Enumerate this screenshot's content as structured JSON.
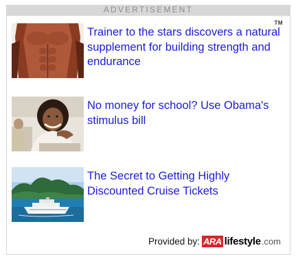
{
  "header": {
    "label": "ADVERTISEMENT"
  },
  "ad_box": {
    "tm_mark": "TM"
  },
  "ads": [
    {
      "headline": "Trainer to the stars discovers a natural supplement for building strength and endurance",
      "image": "muscular-torso-photo"
    },
    {
      "headline": "No money for school? Use Obama's stimulus bill",
      "image": "smiling-student-photo"
    },
    {
      "headline": "The Secret to Getting Highly Discounted Cruise Tickets",
      "image": "cruise-ship-photo"
    }
  ],
  "footer": {
    "provided_by": "Provided by:",
    "logo_ara": "ARA",
    "logo_lifestyle": "lifestyle",
    "logo_com": ".com"
  },
  "colors": {
    "link": "#1b1bd6",
    "header_bg": "#d7d7d7",
    "header_text": "#8d8d8d",
    "box_border": "#d3d3d3",
    "logo_red": "#d8262c"
  }
}
